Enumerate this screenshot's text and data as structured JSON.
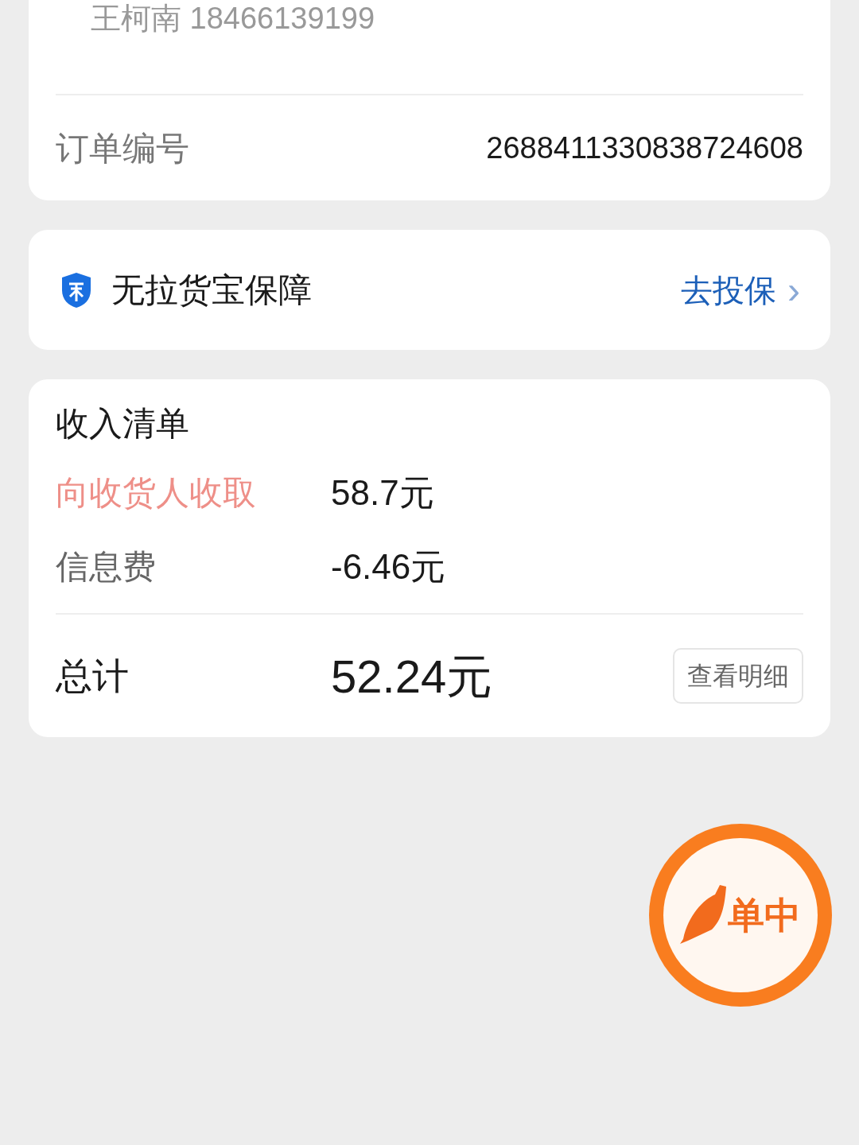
{
  "order_card": {
    "contact": "王柯南 18466139199",
    "order_label": "订单编号",
    "order_number": "2688411330838724608"
  },
  "insurance": {
    "title": "无拉货宝保障",
    "action": "去投保",
    "chevron": "›"
  },
  "income": {
    "title": "收入清单",
    "items": [
      {
        "label": "向收货人收取",
        "amount": "58.7元",
        "highlighted": true
      },
      {
        "label": "信息费",
        "amount": "-6.46元",
        "highlighted": false
      }
    ],
    "total_label": "总计",
    "total": "52.24元",
    "detail_button": "查看明细"
  },
  "floating_button": {
    "text": "单中"
  }
}
